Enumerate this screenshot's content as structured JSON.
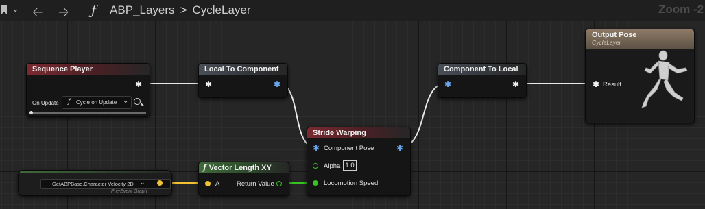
{
  "toolbar": {
    "bookmark_icon": "bookmark-icon",
    "back_icon": "arrow-left-icon",
    "forward_icon": "arrow-right-icon",
    "function_glyph": "ƒ",
    "graph_name": "ABP_Layers",
    "separator": ">",
    "function_name": "CycleLayer",
    "zoom": "Zoom -2"
  },
  "nodes": {
    "sequence_player": {
      "title": "Sequence Player",
      "on_update_label": "On Update",
      "on_update_value": "Cycle on Update",
      "fn_glyph": "ƒ"
    },
    "local_to_component": {
      "title": "Local To Component"
    },
    "component_to_local": {
      "title": "Component To Local"
    },
    "stride_warping": {
      "title": "Stride Warping",
      "component_pose": "Component Pose",
      "alpha_label": "Alpha",
      "alpha_value": "1.0",
      "locomotion_speed": "Locomotion Speed"
    },
    "vector_length": {
      "fn_glyph": "ƒ",
      "title": "Vector Length XY",
      "input_a": "A",
      "output": "Return Value"
    },
    "get_property": {
      "value": "GetABPBase.Character Velocity 2D",
      "subtitle": "Pre-Event Graph"
    },
    "output_pose": {
      "title": "Output Pose",
      "subtitle": "CycleLayer",
      "result": "Result"
    }
  },
  "colors": {
    "pose_pin_white": "#f2f2f2",
    "pose_pin_blue": "#6aa5ee",
    "float_pin_green": "#35c51e",
    "vector_pin_yellow": "#f2c232",
    "red_header": "#7a2a30",
    "green_header": "#3f6b3a"
  }
}
